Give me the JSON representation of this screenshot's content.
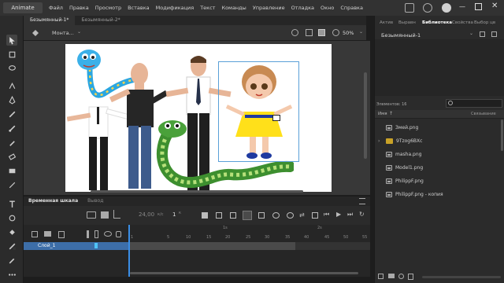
{
  "app": {
    "title": "Animate"
  },
  "menu": [
    "Файл",
    "Правка",
    "Просмотр",
    "Вставка",
    "Модификация",
    "Текст",
    "Команды",
    "Управление",
    "Отладка",
    "Окно",
    "Справка"
  ],
  "doc_tabs": [
    "Безымянный-1*",
    "Безымянный-2*"
  ],
  "scene": {
    "selector": "Монта...",
    "zoom": "50%"
  },
  "timeline": {
    "tabs": [
      "Временная шкала",
      "Вывод"
    ],
    "fps": "24,00",
    "fps_unit": "к/с",
    "frame": "1",
    "frame_unit": "к",
    "seconds_marks": [
      "1s",
      "2s"
    ],
    "frame_ruler": [
      "1",
      "5",
      "10",
      "15",
      "20",
      "25",
      "30",
      "35",
      "40",
      "45",
      "50",
      "55"
    ],
    "layer_name": "Слой_1"
  },
  "right_panel": {
    "tabs": [
      "Актив",
      "Выравн",
      "Библиотека",
      "Свойства",
      "Выбор цв"
    ],
    "active_tab": "Библиотека",
    "doc_select": "Безымянный-1",
    "items_count": "Элементов: 16",
    "col_name": "Имя",
    "col_link": "Связывание",
    "items": [
      "Змей.png",
      "9Tzog6BXc",
      "masha.png",
      "Model1.png",
      "PhilippF.png",
      "PhilippF.png - копия"
    ]
  }
}
